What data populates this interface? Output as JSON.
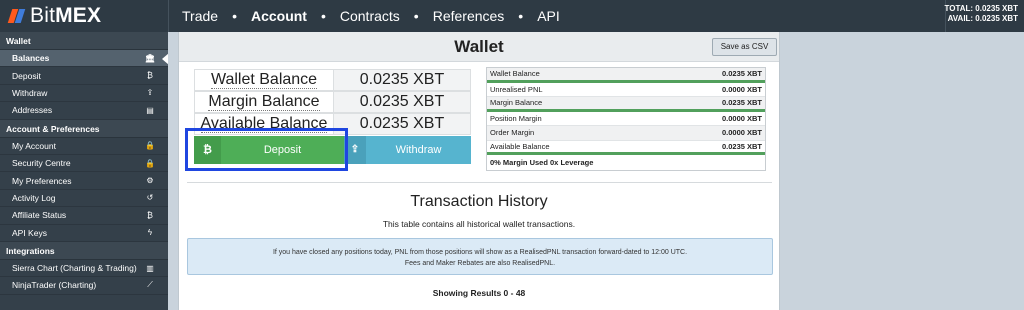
{
  "header": {
    "brand_light": "Bit",
    "brand_bold": "MEX",
    "nav": [
      "Trade",
      "Account",
      "Contracts",
      "References",
      "API"
    ],
    "active_nav": "Account",
    "total": "TOTAL: 0.0235 XBT",
    "avail": "AVAIL: 0.0235 XBT"
  },
  "sidebar": {
    "wallet_heading": "Wallet",
    "wallet_items": [
      {
        "label": "Balances",
        "icon": "bank-icon",
        "glyph": "🏛"
      },
      {
        "label": "Deposit",
        "icon": "bitcoin-icon",
        "glyph": "₿"
      },
      {
        "label": "Withdraw",
        "icon": "upload-icon",
        "glyph": "⇪"
      },
      {
        "label": "Addresses",
        "icon": "document-icon",
        "glyph": "▤"
      }
    ],
    "account_heading": "Account & Preferences",
    "account_items": [
      {
        "label": "My Account",
        "icon": "lock-icon",
        "glyph": "🔒"
      },
      {
        "label": "Security Centre",
        "icon": "lock-icon",
        "glyph": "🔒"
      },
      {
        "label": "My Preferences",
        "icon": "gear-icon",
        "glyph": "⚙"
      },
      {
        "label": "Activity Log",
        "icon": "history-icon",
        "glyph": "↺"
      },
      {
        "label": "Affiliate Status",
        "icon": "bitcoin-icon",
        "glyph": "₿"
      },
      {
        "label": "API Keys",
        "icon": "bolt-icon",
        "glyph": "ϟ"
      }
    ],
    "integrations_heading": "Integrations",
    "integration_items": [
      {
        "label": "Sierra Chart (Charting & Trading)",
        "icon": "bar-chart-icon",
        "glyph": "▥"
      },
      {
        "label": "NinjaTrader (Charting)",
        "icon": "line-chart-icon",
        "glyph": "⟋"
      }
    ]
  },
  "wallet": {
    "title": "Wallet",
    "csv_button": "Save as CSV",
    "balances": [
      {
        "label": "Wallet Balance",
        "value": "0.0235 XBT"
      },
      {
        "label": "Margin Balance",
        "value": "0.0235 XBT"
      },
      {
        "label": "Available Balance",
        "value": "0.0235 XBT"
      }
    ],
    "deposit_icon": "₿",
    "deposit_label": "Deposit",
    "withdraw_icon": "⇪",
    "withdraw_label": "Withdraw",
    "margin_rows": [
      {
        "label": "Wallet Balance",
        "value": "0.0235 XBT"
      },
      {
        "label": "Unrealised PNL",
        "value": "0.0000 XBT"
      },
      {
        "label": "Margin Balance",
        "value": "0.0235 XBT"
      },
      {
        "label": "Position Margin",
        "value": "0.0000 XBT"
      },
      {
        "label": "Order Margin",
        "value": "0.0000 XBT"
      },
      {
        "label": "Available Balance",
        "value": "0.0235 XBT"
      }
    ],
    "margin_footer": "0% Margin Used 0x Leverage"
  },
  "history": {
    "title": "Transaction History",
    "subtitle": "This table contains all historical wallet transactions.",
    "info_line1": "If you have closed any positions today, PNL from those positions will show as a RealisedPNL transaction forward-dated to 12:00 UTC.",
    "info_line2": "Fees and Maker Rebates are also RealisedPNL.",
    "showing": "Showing Results 0 - 48"
  },
  "colors": {
    "deposit": "#4eae57",
    "withdraw": "#56b4cf",
    "highlight": "#1f46e0",
    "nav_bg": "#2e3a44"
  }
}
